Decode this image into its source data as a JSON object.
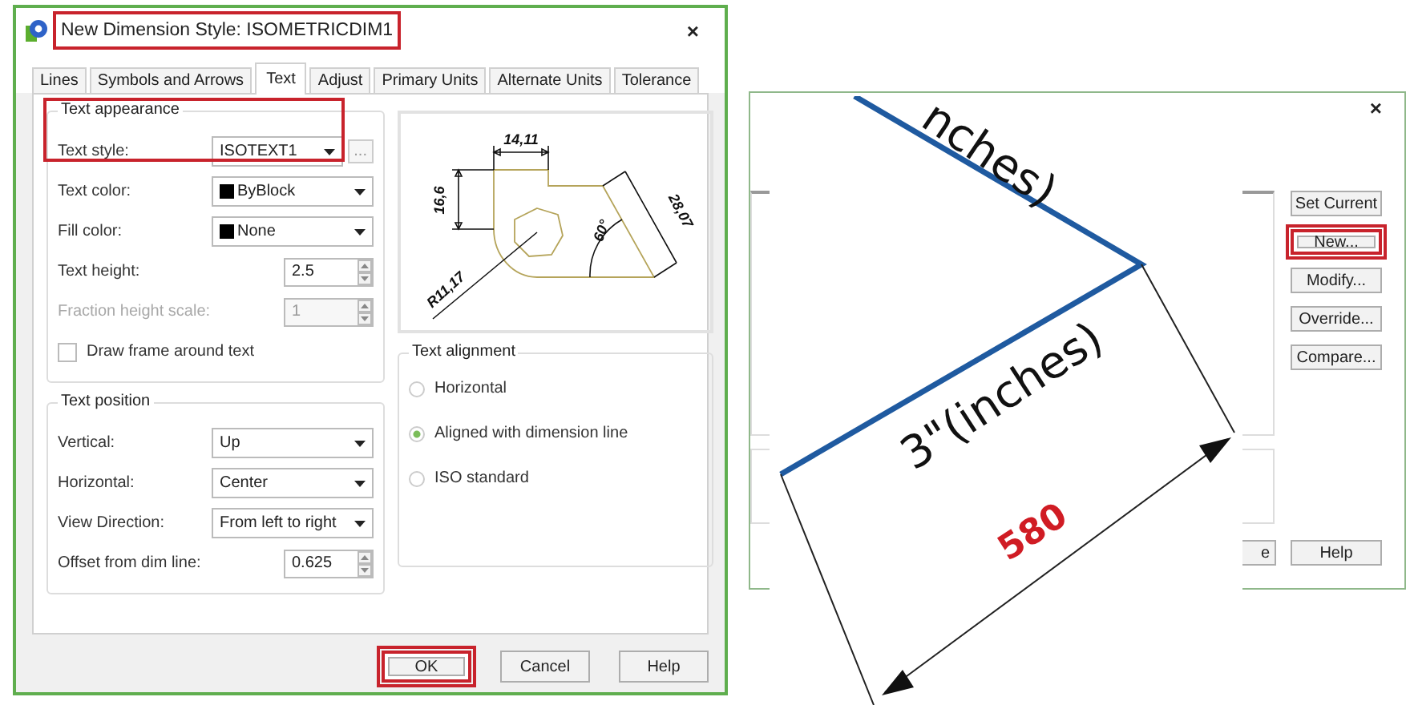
{
  "style_dialog": {
    "title": "New Dimension Style: ISOMETRICDIM1",
    "title_highlighted": true,
    "close": "×",
    "tabs": [
      {
        "label": "Lines",
        "selected": false
      },
      {
        "label": "Symbols and Arrows",
        "selected": false
      },
      {
        "label": "Text",
        "selected": true
      },
      {
        "label": "Adjust",
        "selected": false
      },
      {
        "label": "Primary Units",
        "selected": false
      },
      {
        "label": "Alternate Units",
        "selected": false
      },
      {
        "label": "Tolerance",
        "selected": false
      }
    ],
    "text_appearance": {
      "title": "Text appearance",
      "highlighted": true,
      "fields": [
        {
          "kind": "select",
          "label": "Text style:",
          "value": "ISOTEXT1",
          "browse": "...",
          "disabled": false
        },
        {
          "kind": "select",
          "label": "Text color:",
          "value": "ByBlock",
          "color": "#000000",
          "disabled": false
        },
        {
          "kind": "select",
          "label": "Fill color:",
          "value": "None",
          "color": "#000000",
          "disabled": false
        },
        {
          "kind": "spin",
          "label": "Text height:",
          "value": "2.5",
          "disabled": false
        },
        {
          "kind": "spin",
          "label": "Fraction height scale:",
          "value": "1",
          "disabled": true
        },
        {
          "kind": "check",
          "label": "Draw frame around text",
          "checked": false,
          "disabled": false
        }
      ]
    },
    "text_position": {
      "title": "Text position",
      "fields": [
        {
          "kind": "select",
          "label": "Vertical:",
          "value": "Up",
          "disabled": false
        },
        {
          "kind": "select",
          "label": "Horizontal:",
          "value": "Center",
          "disabled": false
        },
        {
          "kind": "select",
          "label": "View Direction:",
          "value": "From left to right",
          "disabled": false
        },
        {
          "kind": "spin",
          "label": "Offset from dim line:",
          "value": "0.625",
          "disabled": false
        }
      ]
    },
    "preview": {
      "labels": [
        "14,11",
        "16,6",
        "28,07",
        "60°",
        "R11,17"
      ]
    },
    "text_alignment": {
      "title": "Text alignment",
      "options": [
        {
          "label": "Horizontal",
          "selected": false
        },
        {
          "label": "Aligned with dimension line",
          "selected": true
        },
        {
          "label": "ISO standard",
          "selected": false
        }
      ]
    },
    "buttons": [
      {
        "label": "OK",
        "highlighted": true
      },
      {
        "label": "Cancel",
        "highlighted": false
      },
      {
        "label": "Help",
        "highlighted": false
      }
    ]
  },
  "manager_dialog": {
    "close": "×",
    "buttons": [
      {
        "label": "Set Current",
        "highlighted": false
      },
      {
        "label": "New...",
        "highlighted": true
      },
      {
        "label": "Modify...",
        "highlighted": false
      },
      {
        "label": "Override...",
        "highlighted": false
      },
      {
        "label": "Compare...",
        "highlighted": false
      }
    ],
    "bottom_buttons": [
      {
        "label": "e"
      },
      {
        "label": "Help"
      }
    ]
  },
  "overlay_drawing": {
    "labels": [
      "nches)",
      "3\"(inches)",
      "580"
    ]
  }
}
